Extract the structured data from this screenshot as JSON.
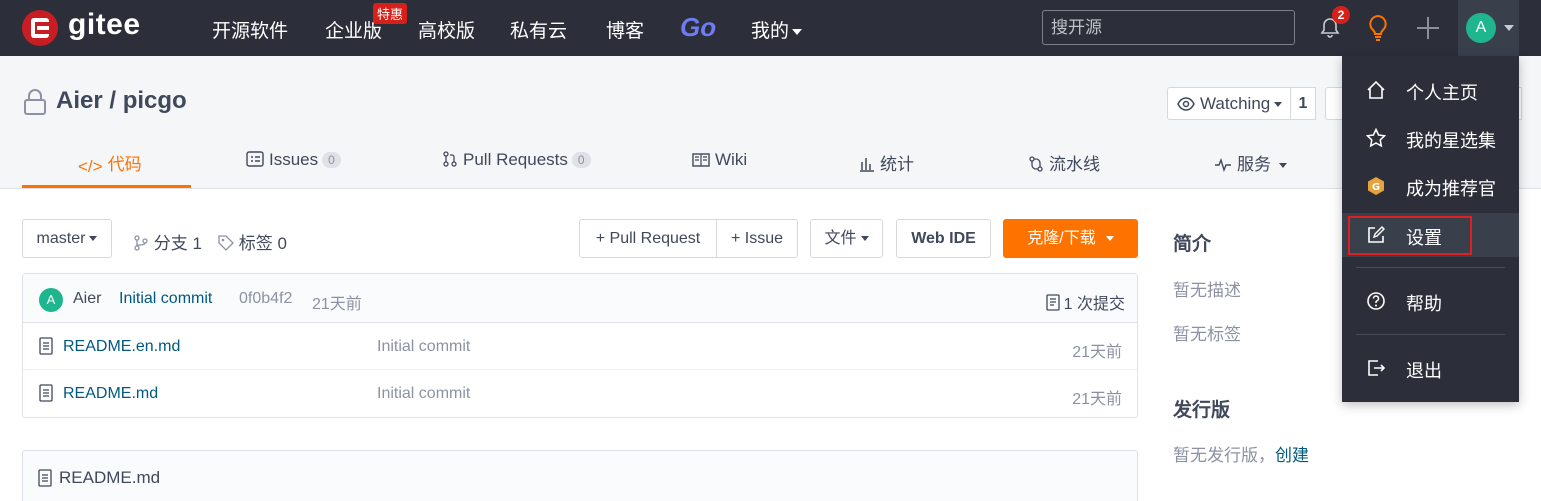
{
  "nav": {
    "logo_text": "gitee",
    "items": [
      "开源软件",
      "企业版",
      "高校版",
      "私有云",
      "博客"
    ],
    "go_label": "Go",
    "special_badge": "特惠",
    "mine_label": "我的",
    "search_placeholder": "搜开源",
    "notification_count": "2",
    "avatar_letter": "A"
  },
  "repo": {
    "path": "Aier / picgo",
    "watch_label": "Watching",
    "watch_count": "1"
  },
  "tabs": [
    {
      "label": "代码",
      "icon": "code-icon"
    },
    {
      "label": "Issues",
      "icon": "issues-icon",
      "count": "0"
    },
    {
      "label": "Pull Requests",
      "icon": "pull-request-icon",
      "count": "0"
    },
    {
      "label": "Wiki",
      "icon": "wiki-icon"
    },
    {
      "label": "统计",
      "icon": "stats-icon"
    },
    {
      "label": "流水线",
      "icon": "pipeline-icon"
    },
    {
      "label": "服务",
      "icon": "service-icon"
    }
  ],
  "toolbar": {
    "branch": "master",
    "branch_info": "分支 1",
    "tag_info": "标签 0",
    "pull_request_btn": "+ Pull Request",
    "issue_btn": "+ Issue",
    "file_btn": "文件",
    "webide_btn": "Web IDE",
    "clone_btn": "克隆/下载"
  },
  "latest_commit": {
    "avatar_letter": "A",
    "author": "Aier",
    "message": "Initial commit",
    "hash": "0f0b4f2",
    "time": "21天前",
    "count_label": "1 次提交"
  },
  "files": [
    {
      "name": "README.en.md",
      "commit": "Initial commit",
      "time": "21天前"
    },
    {
      "name": "README.md",
      "commit": "Initial commit",
      "time": "21天前"
    }
  ],
  "readme": {
    "title": "README.md"
  },
  "sidebar": {
    "intro_heading": "简介",
    "no_desc": "暂无描述",
    "no_tags": "暂无标签",
    "release_heading": "发行版",
    "no_release": "暂无发行版，",
    "create_link": "创建"
  },
  "user_menu": [
    {
      "label": "个人主页",
      "icon": "home-icon"
    },
    {
      "label": "我的星选集",
      "icon": "star-icon"
    },
    {
      "label": "成为推荐官",
      "icon": "recommender-badge-icon"
    },
    {
      "label": "设置",
      "icon": "settings-edit-icon"
    },
    {
      "label": "帮助",
      "icon": "help-icon"
    },
    {
      "label": "退出",
      "icon": "logout-icon"
    }
  ],
  "colors": {
    "accent": "#fe7300",
    "nav_bg": "#2c2f3a",
    "link": "#005980",
    "highlight_border": "#e02020"
  }
}
